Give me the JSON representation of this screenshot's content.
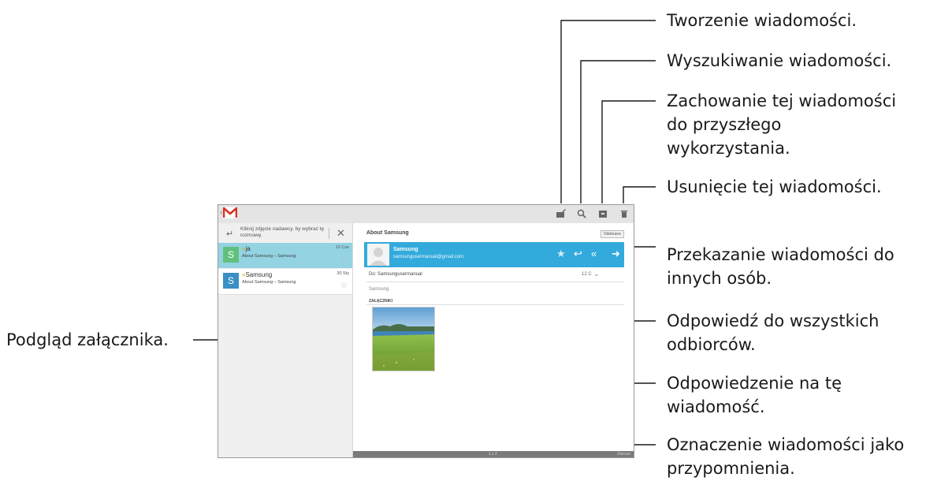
{
  "callouts": {
    "compose": "Tworzenie wiadomości.",
    "search": "Wyszukiwanie wiadomości.",
    "archive_lines": [
      "Zachowanie tej wiadomości",
      "do przyszłego",
      "wykorzystania."
    ],
    "delete": "Usunięcie tej wiadomości.",
    "forward_lines": [
      "Przekazanie wiadomości do",
      "innych osób."
    ],
    "reply_all_lines": [
      "Odpowiedź do wszystkich",
      "odbiorców."
    ],
    "reply_lines": [
      "Odpowiedzenie na tę",
      "wiadomość."
    ],
    "star_lines": [
      "Oznaczenie wiadomości jako",
      "przypomnienia."
    ],
    "attachment_preview": "Podgląd załącznika."
  },
  "screen": {
    "hint": "Kliknij zdjęcie nadawcy, by wybrać tę rozmowę.",
    "conversations": [
      {
        "avatar_letter": "S",
        "avatar_color": "#62c07e",
        "sender": "ja",
        "subject": "About Samsung – Samsung",
        "date": "12 Cze",
        "selected": true
      },
      {
        "avatar_letter": "S",
        "avatar_color": "#3a8fc4",
        "sender": "Samsung",
        "subject": "About Samsung – Samsung",
        "date": "30 Sty",
        "selected": false
      }
    ],
    "message": {
      "subject": "About Samsung",
      "label_button": "Odebrane",
      "sender_name": "Samsung",
      "sender_email": "samsungusermanual@gmail.com",
      "to": "Do: Samsungusermanual",
      "date": "12 C",
      "body": "Samsung",
      "attachments_label": "ZAŁĄCZNIKI"
    },
    "pager": "1 z 2",
    "next_label": "Starsze",
    "accent_color": "#33aadc"
  }
}
